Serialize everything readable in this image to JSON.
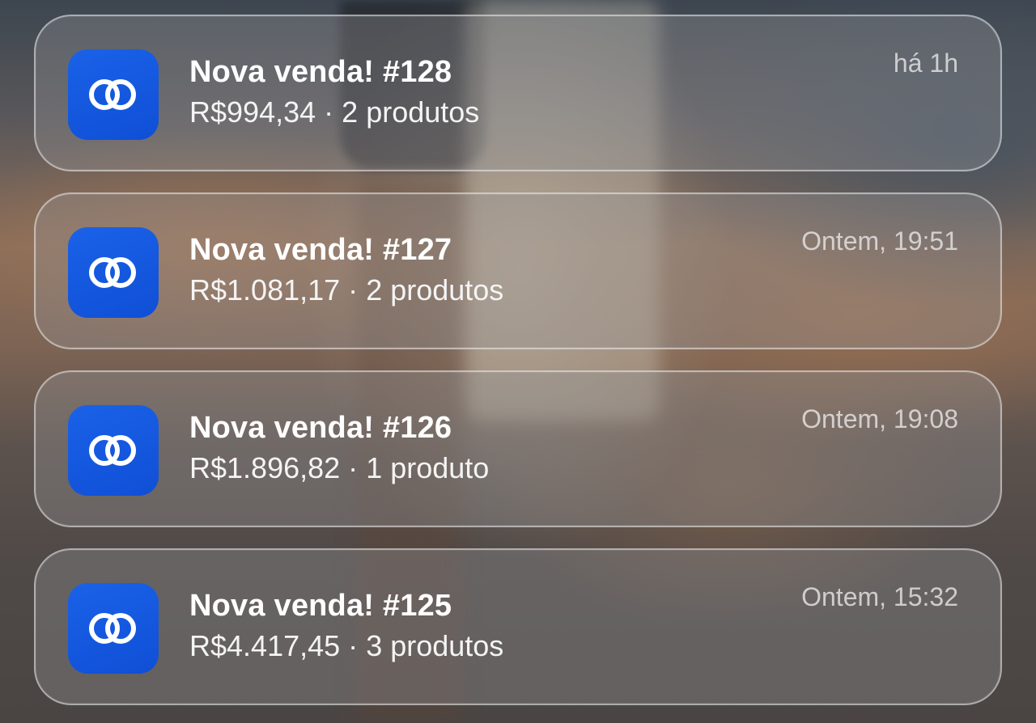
{
  "notifications": [
    {
      "title": "Nova venda! #128",
      "amount": "R$994,34",
      "separator": "·",
      "items": "2 produtos",
      "time": "há 1h"
    },
    {
      "title": "Nova venda! #127",
      "amount": "R$1.081,17",
      "separator": "·",
      "items": "2 produtos",
      "time": "Ontem, 19:51"
    },
    {
      "title": "Nova venda! #126",
      "amount": "R$1.896,82",
      "separator": "·",
      "items": "1 produto",
      "time": "Ontem, 19:08"
    },
    {
      "title": "Nova venda! #125",
      "amount": "R$4.417,45",
      "separator": "·",
      "items": "3 produtos",
      "time": "Ontem, 15:32"
    }
  ],
  "app_icon": {
    "name": "linked-rings-icon",
    "color": "#1a5fe5"
  }
}
